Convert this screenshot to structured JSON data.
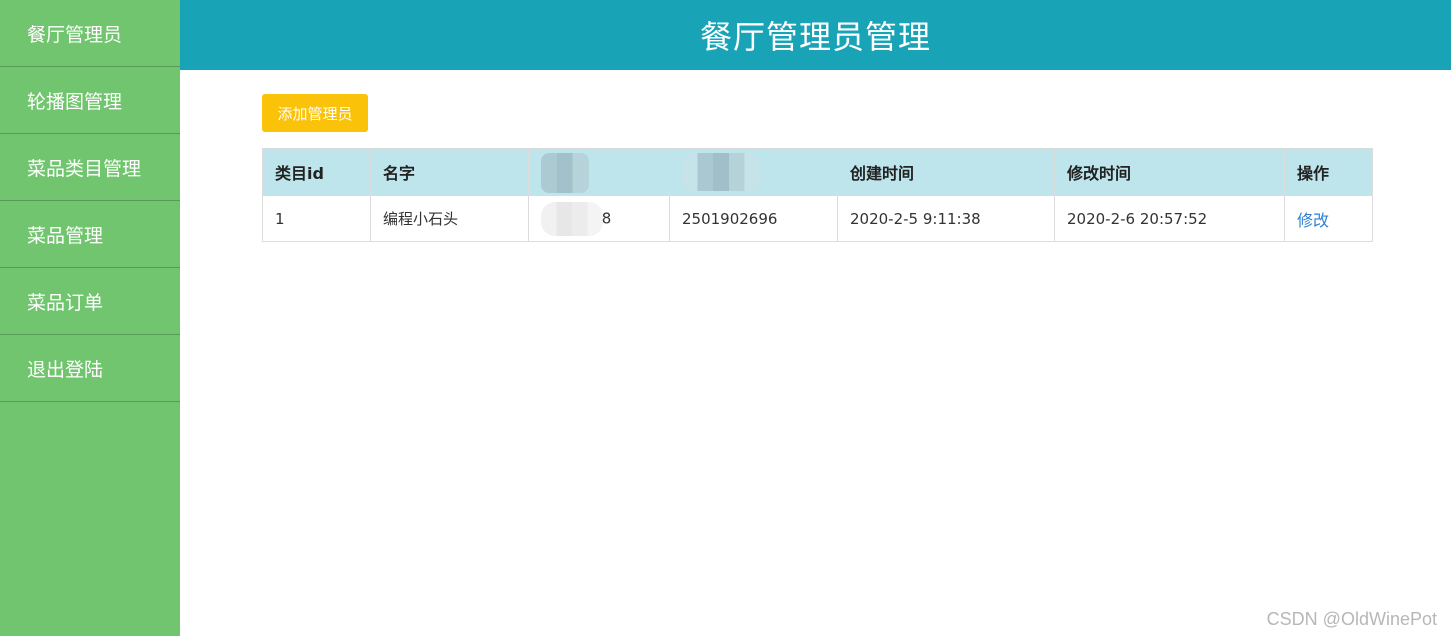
{
  "sidebar": {
    "items": [
      {
        "label": "餐厅管理员"
      },
      {
        "label": "轮播图管理"
      },
      {
        "label": "菜品类目管理"
      },
      {
        "label": "菜品管理"
      },
      {
        "label": "菜品订单"
      },
      {
        "label": "退出登陆"
      }
    ]
  },
  "header": {
    "title": "餐厅管理员管理"
  },
  "toolbar": {
    "add_label": "添加管理员"
  },
  "table": {
    "headers": [
      "类目id",
      "名字",
      "",
      "",
      "创建时间",
      "修改时间",
      "操作"
    ],
    "rows": [
      {
        "id": "1",
        "name": "编程小石头",
        "col3_suffix": "8",
        "col4": "2501902696",
        "created": "2020-2-5 9:11:38",
        "modified": "2020-2-6 20:57:52",
        "action": "修改"
      }
    ]
  },
  "watermark": {
    "text": "CSDN @OldWinePot"
  },
  "colors": {
    "sidebar_bg": "#70c56e",
    "header_bg": "#18a3b7",
    "add_button_bg": "#fbc20a",
    "table_header_bg": "#bfe5ec",
    "link": "#2f7fd4"
  }
}
